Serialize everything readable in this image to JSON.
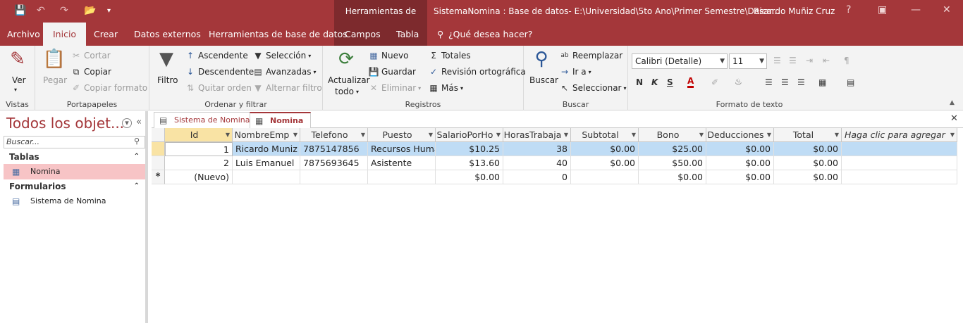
{
  "title_bar": {
    "context_title": "Herramientas de tabla",
    "document_title": "SistemaNomina : Base de datos- E:\\Universidad\\5to Ano\\Primer Semestre\\Desar...",
    "user": "Ricardo Muñiz Cruz",
    "help": "?"
  },
  "ribbon_tabs": [
    "Archivo",
    "Inicio",
    "Crear",
    "Datos externos",
    "Herramientas de base de datos",
    "Campos",
    "Tabla"
  ],
  "tell_me": "¿Qué desea hacer?",
  "groups": {
    "vistas": {
      "label": "Vistas",
      "ver": "Ver"
    },
    "portapapeles": {
      "label": "Portapapeles",
      "pegar": "Pegar",
      "cortar": "Cortar",
      "copiar": "Copiar",
      "copiar_formato": "Copiar formato"
    },
    "ordenar": {
      "label": "Ordenar y filtrar",
      "filtro": "Filtro",
      "ascendente": "Ascendente",
      "descendente": "Descendente",
      "quitar_orden": "Quitar orden",
      "seleccion": "Selección",
      "avanzadas": "Avanzadas",
      "alternar_filtro": "Alternar filtro"
    },
    "registros": {
      "label": "Registros",
      "actualizar": "Actualizar",
      "todo": "todo",
      "nuevo": "Nuevo",
      "guardar": "Guardar",
      "eliminar": "Eliminar",
      "totales": "Totales",
      "revision": "Revisión ortográfica",
      "mas": "Más"
    },
    "buscar": {
      "label": "Buscar",
      "buscar": "Buscar",
      "reemplazar": "Reemplazar",
      "ir_a": "Ir a",
      "seleccionar": "Seleccionar"
    },
    "formato": {
      "label": "Formato de texto",
      "font": "Calibri (Detalle)",
      "size": "11"
    }
  },
  "nav": {
    "title": "Todos los objet...",
    "search_placeholder": "Buscar...",
    "sections": [
      {
        "label": "Tablas",
        "items": [
          "Nomina"
        ]
      },
      {
        "label": "Formularios",
        "items": [
          "Sistema de Nomina"
        ]
      }
    ]
  },
  "doc_tabs": [
    "Sistema de Nomina",
    "Nomina"
  ],
  "table": {
    "columns": [
      "Id",
      "NombreEmp",
      "Telefono",
      "Puesto",
      "SalarioPorHo",
      "HorasTrabaja",
      "Subtotal",
      "Bono",
      "Deducciones",
      "Total",
      "Haga clic para agregar"
    ],
    "rows": [
      [
        "1",
        "Ricardo Muniz",
        "7875147856",
        "Recursos Huma",
        "$10.25",
        "38",
        "$0.00",
        "$25.00",
        "$0.00",
        "$0.00",
        ""
      ],
      [
        "2",
        "Luis Emanuel",
        "7875693645",
        "Asistente",
        "$13.60",
        "40",
        "$0.00",
        "$50.00",
        "$0.00",
        "$0.00",
        ""
      ],
      [
        "(Nuevo)",
        "",
        "",
        "",
        "$0.00",
        "0",
        "",
        "$0.00",
        "$0.00",
        "$0.00",
        ""
      ]
    ],
    "new_row_marker": "*",
    "selected_row": 1
  }
}
